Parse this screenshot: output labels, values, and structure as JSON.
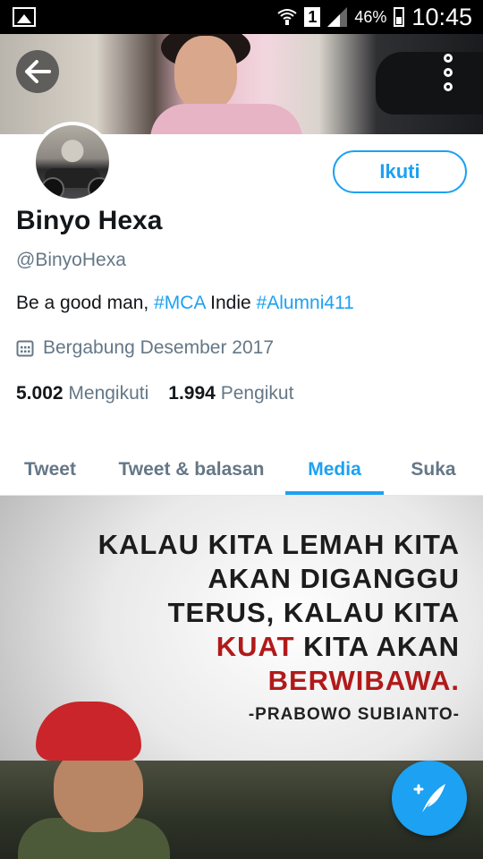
{
  "status_bar": {
    "battery": "46%",
    "time": "10:45",
    "sim": "1"
  },
  "profile": {
    "name": "Binyo Hexa",
    "handle": "@BinyoHexa",
    "bio": {
      "prefix": "Be a good man, ",
      "tag1": "#MCA",
      "middle": " Indie ",
      "tag2": "#Alumni411"
    },
    "joined": "Bergabung Desember 2017",
    "following_count": "5.002",
    "following_label": "Mengikuti",
    "followers_count": "1.994",
    "followers_label": "Pengikut",
    "follow_button": "Ikuti"
  },
  "tabs": [
    {
      "label": "Tweet",
      "active": false
    },
    {
      "label": "Tweet & balasan",
      "active": false
    },
    {
      "label": "Media",
      "active": true
    },
    {
      "label": "Suka",
      "active": false
    }
  ],
  "media_post": {
    "line1": "KALAU KITA LEMAH KITA",
    "line2": "AKAN DIGANGGU",
    "line3": "TERUS, KALAU KITA",
    "line4_red": "KUAT",
    "line4_rest": " KITA AKAN",
    "line5": "BERWIBAWA.",
    "author": "-PRABOWO SUBIANTO-"
  },
  "colors": {
    "accent": "#1da1f2",
    "text_primary": "#14171a",
    "text_secondary": "#657786"
  },
  "icons": {
    "back": "arrow-left-icon",
    "more": "more-vertical-icon",
    "calendar": "calendar-icon",
    "compose": "compose-tweet-icon"
  }
}
